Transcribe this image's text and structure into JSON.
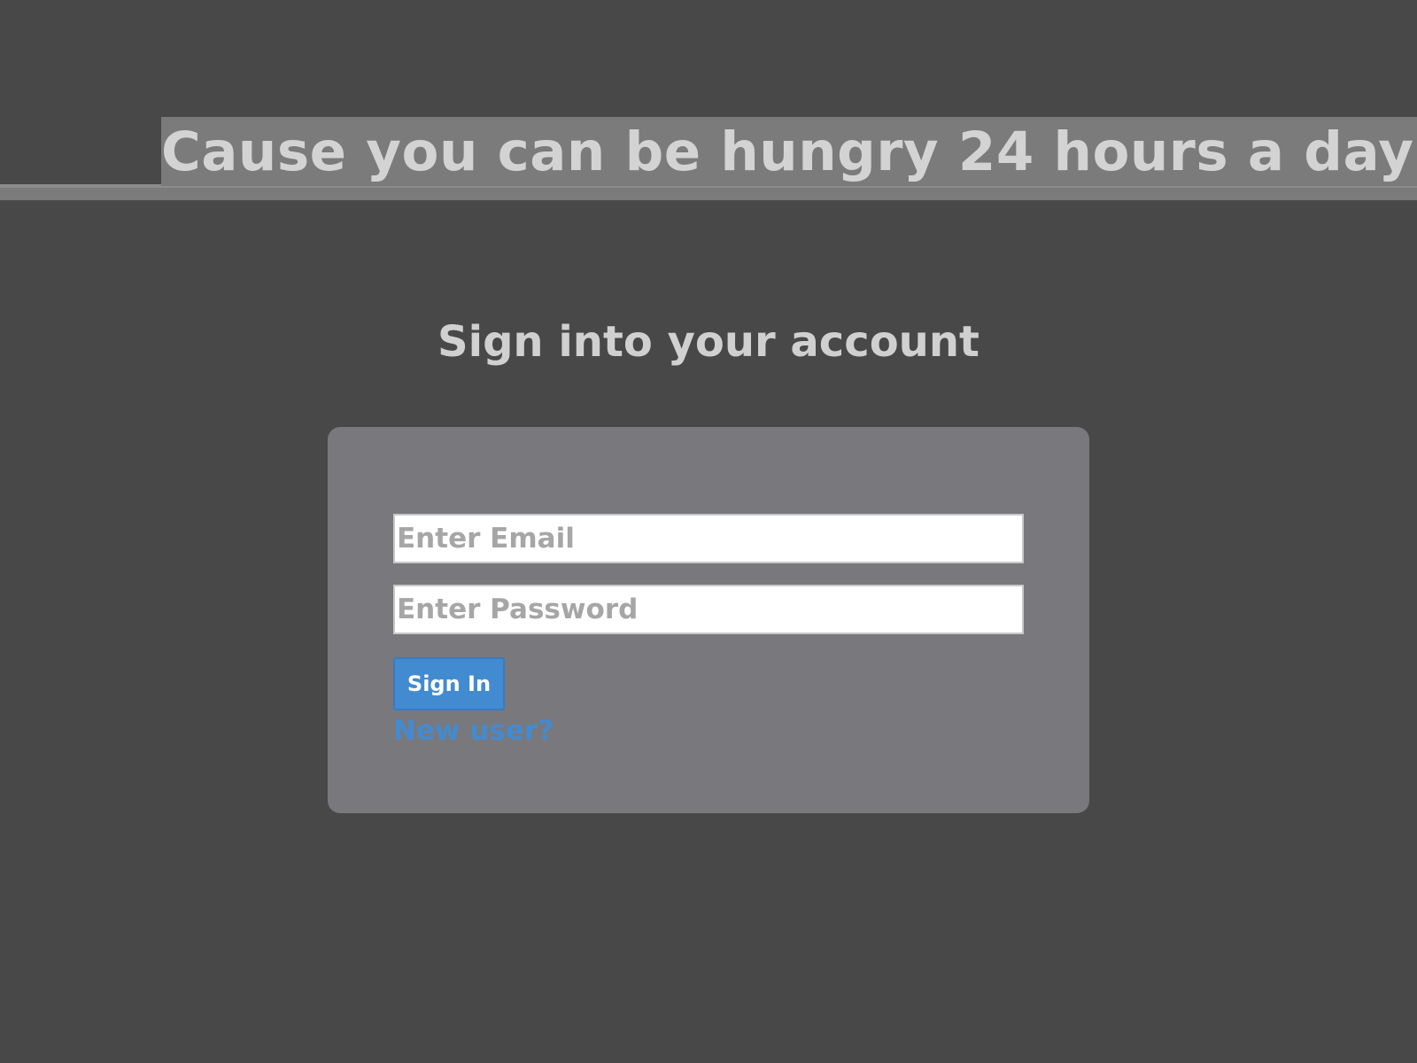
{
  "header": {
    "tagline": "Cause you can be hungry 24 hours a day"
  },
  "signin": {
    "heading": "Sign into your account",
    "email_placeholder": "Enter Email",
    "password_placeholder": "Enter Password",
    "submit_label": "Sign In",
    "new_user_link": "New user?"
  },
  "colors": {
    "page_background": "#484848",
    "banner_background": "#7b7b7b",
    "card_background": "#78787d",
    "accent": "#438bd0",
    "heading_text": "#d0d0d0"
  }
}
